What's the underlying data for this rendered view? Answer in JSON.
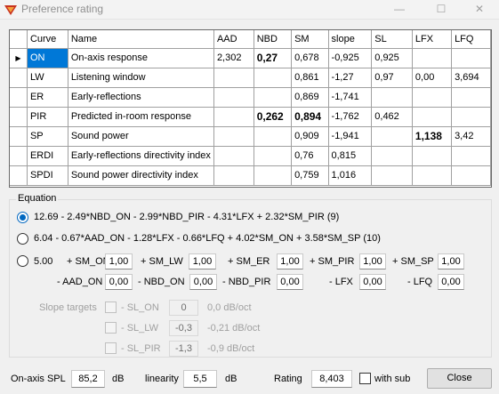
{
  "window": {
    "title": "Preference rating",
    "minimize": "—",
    "maximize": "☐",
    "close": "✕"
  },
  "grid": {
    "headers": [
      "Curve",
      "Name",
      "AAD",
      "NBD",
      "SM",
      "slope",
      "SL",
      "LFX",
      "LFQ"
    ],
    "rows": [
      {
        "curve": "ON",
        "name": "On-axis response",
        "aad": "2,302",
        "nbd": "0,27",
        "sm": "0,678",
        "slope": "-0,925",
        "sl": "0,925",
        "lfx": "",
        "lfq": ""
      },
      {
        "curve": "LW",
        "name": "Listening window",
        "aad": "",
        "nbd": "",
        "sm": "0,861",
        "slope": "-1,27",
        "sl": "0,97",
        "lfx": "0,00",
        "lfq": "3,694"
      },
      {
        "curve": "ER",
        "name": "Early-reflections",
        "aad": "",
        "nbd": "",
        "sm": "0,869",
        "slope": "-1,741",
        "sl": "",
        "lfx": "",
        "lfq": ""
      },
      {
        "curve": "PIR",
        "name": "Predicted in-room response",
        "aad": "",
        "nbd": "0,262",
        "sm": "0,894",
        "slope": "-1,762",
        "sl": "0,462",
        "lfx": "",
        "lfq": ""
      },
      {
        "curve": "SP",
        "name": "Sound power",
        "aad": "",
        "nbd": "",
        "sm": "0,909",
        "slope": "-1,941",
        "sl": "",
        "lfx": "1,138",
        "lfq": "3,42"
      },
      {
        "curve": "ERDI",
        "name": "Early-reflections directivity index",
        "aad": "",
        "nbd": "",
        "sm": "0,76",
        "slope": "0,815",
        "sl": "",
        "lfx": "",
        "lfq": ""
      },
      {
        "curve": "SPDI",
        "name": "Sound power directivity index",
        "aad": "",
        "nbd": "",
        "sm": "0,759",
        "slope": "1,016",
        "sl": "",
        "lfx": "",
        "lfq": ""
      }
    ],
    "row_indicator": "▶"
  },
  "equation": {
    "group_label": "Equation",
    "option1": "12.69 - 2.49*NBD_ON - 2.99*NBD_PIR - 4.31*LFX + 2.32*SM_PIR (9)",
    "option2": "6.04 - 0.67*AAD_ON - 1.28*LFX - 0.66*LFQ + 4.02*SM_ON + 3.58*SM_SP (10)",
    "custom": {
      "constant": "5.00",
      "sm_on_label": "+ SM_ON",
      "sm_on": "1,00",
      "sm_lw_label": "+ SM_LW",
      "sm_lw": "1,00",
      "sm_er_label": "+ SM_ER",
      "sm_er": "1,00",
      "sm_pir_label": "+ SM_PIR",
      "sm_pir": "1,00",
      "sm_sp_label": "+ SM_SP",
      "sm_sp": "1,00",
      "aad_on_label": "- AAD_ON",
      "aad_on": "0,00",
      "nbd_on_label": "- NBD_ON",
      "nbd_on": "0,00",
      "nbd_pir_label": "- NBD_PIR",
      "nbd_pir": "0,00",
      "lfx_label": "- LFX",
      "lfx": "0,00",
      "lfq_label": "- LFQ",
      "lfq": "0,00"
    },
    "slope_targets": {
      "label": "Slope targets",
      "on_label": "- SL_ON",
      "on_value": "0",
      "on_unit": "0,0 dB/oct",
      "lw_label": "- SL_LW",
      "lw_value": "-0,3",
      "lw_unit": "-0,21 dB/oct",
      "pir_label": "- SL_PIR",
      "pir_value": "-1,3",
      "pir_unit": "-0,9 dB/oct"
    }
  },
  "footer": {
    "spl_label": "On-axis SPL",
    "spl_value": "85,2",
    "spl_unit": "dB",
    "linearity_label": "linearity",
    "linearity_value": "5,5",
    "linearity_unit": "dB",
    "rating_label": "Rating",
    "rating_value": "8,403",
    "with_sub_label": "with sub",
    "close_label": "Close"
  },
  "colors": {
    "selection": "#0078d7",
    "accent": "#0067c0",
    "app_icon": "#c8321e"
  }
}
